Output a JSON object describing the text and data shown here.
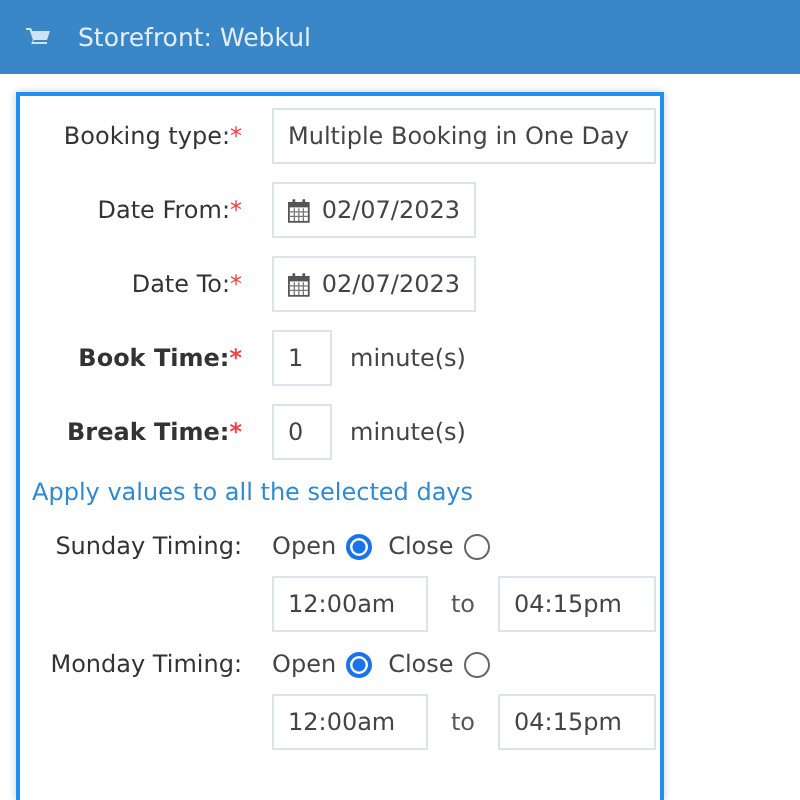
{
  "header": {
    "title": "Storefront: Webkul"
  },
  "fields": [
    {
      "kind": "text",
      "label": "Booking type:",
      "bold": false,
      "required_mark": "*",
      "value": "Multiple Booking in One Day"
    },
    {
      "kind": "date",
      "label": "Date From:",
      "bold": false,
      "required_mark": "*",
      "value": "02/07/2023"
    },
    {
      "kind": "date",
      "label": "Date To:",
      "bold": false,
      "required_mark": "*",
      "value": "02/07/2023"
    },
    {
      "kind": "minutes",
      "label": "Book Time:",
      "bold": true,
      "required_mark": "*",
      "value": "1",
      "unit": "minute(s)"
    },
    {
      "kind": "minutes",
      "label": "Break Time:",
      "bold": true,
      "required_mark": "*",
      "value": "0",
      "unit": "minute(s)"
    }
  ],
  "apply_link": "Apply values to all the selected days",
  "days": [
    {
      "label": "Sunday Timing:",
      "options": [
        {
          "label": "Open",
          "selected": true
        },
        {
          "label": "Close",
          "selected": false
        }
      ],
      "from": "12:00am",
      "separator": "to",
      "to": "04:15pm"
    },
    {
      "label": "Monday Timing:",
      "options": [
        {
          "label": "Open",
          "selected": true
        },
        {
          "label": "Close",
          "selected": false
        }
      ],
      "from": "12:00am",
      "separator": "to",
      "to": "04:15pm"
    }
  ]
}
